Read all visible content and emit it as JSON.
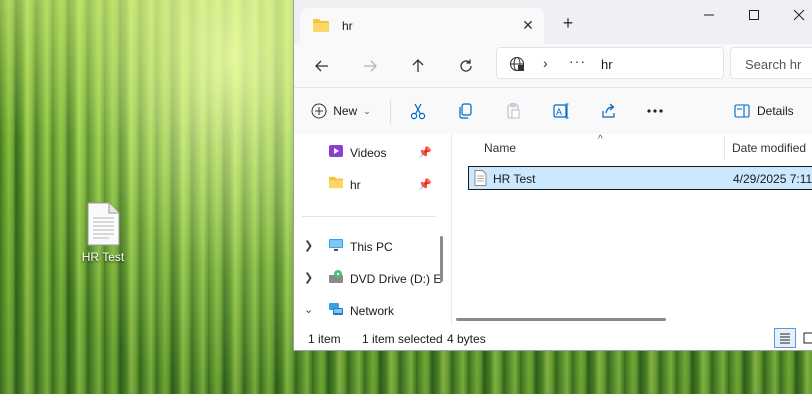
{
  "desktop": {
    "icon_label": "HR Test"
  },
  "window": {
    "tab_title": "hr",
    "new_tab": "+",
    "address": {
      "more": "···",
      "crumb": "hr"
    },
    "search_placeholder": "Search hr",
    "toolbar": {
      "new_label": "New",
      "details_label": "Details"
    },
    "nav": {
      "items": [
        {
          "label": "Videos",
          "pinned": true
        },
        {
          "label": "hr",
          "pinned": true
        },
        {
          "label": "This PC"
        },
        {
          "label": "DVD Drive (D:) E"
        },
        {
          "label": "Network"
        }
      ]
    },
    "columns": {
      "name": "Name",
      "date": "Date modified"
    },
    "files": [
      {
        "name": "HR Test",
        "date_modified": "4/29/2025 7:11",
        "selected": true
      }
    ],
    "status": {
      "count": "1 item",
      "selected": "1 item selected",
      "size": "4 bytes"
    }
  },
  "colors": {
    "accent": "#0067c0",
    "selection": "#cce8ff",
    "folder": "#f8c33a"
  }
}
